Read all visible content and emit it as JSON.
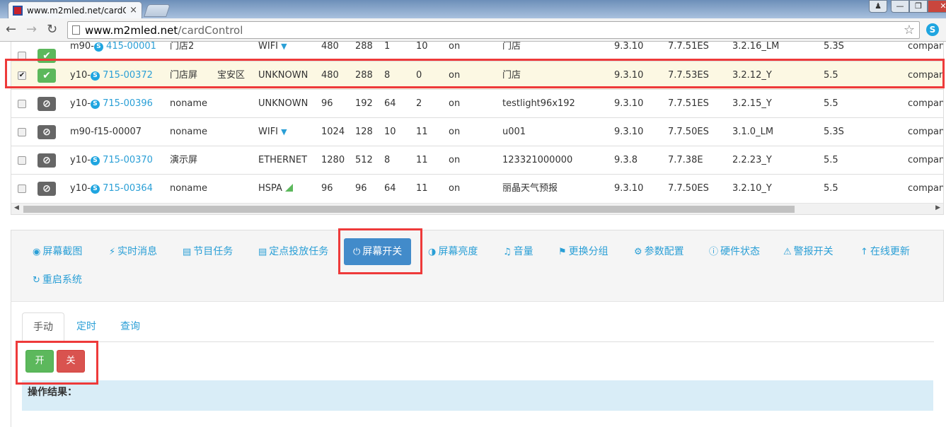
{
  "browser": {
    "tab_title": "www.m2mled.net/cardC",
    "tab_close": "×",
    "url_host": "www.m2mled.net",
    "url_path": "/cardControl",
    "user_icon": "user-icon",
    "window_controls": [
      "minimize",
      "maximize",
      "close"
    ]
  },
  "devices": [
    {
      "selected": false,
      "online": true,
      "id_prefix": "m90-",
      "id_link": "415-00001",
      "has_skype": true,
      "name": "门店2",
      "area": "",
      "network": "WIFI",
      "net_icon": "wifi",
      "width": "480",
      "height": "288",
      "c5": "1",
      "c6": "10",
      "power": "on",
      "group": "门店",
      "v1": "9.3.10",
      "v2": "7.7.51ES",
      "v3": "3.2.16_LM",
      "v4": "5.3S",
      "company": "compan"
    },
    {
      "selected": true,
      "online": true,
      "id_prefix": "y10-",
      "id_link": "715-00372",
      "has_skype": true,
      "name": "门店屏",
      "area": "宝安区",
      "network": "UNKNOWN",
      "net_icon": "",
      "width": "480",
      "height": "288",
      "c5": "8",
      "c6": "0",
      "power": "on",
      "group": "门店",
      "v1": "9.3.10",
      "v2": "7.7.53ES",
      "v3": "3.2.12_Y",
      "v4": "5.5",
      "company": "compan"
    },
    {
      "selected": false,
      "online": false,
      "id_prefix": "y10-",
      "id_link": "715-00396",
      "has_skype": true,
      "name": "noname",
      "area": "",
      "network": "UNKNOWN",
      "net_icon": "",
      "width": "96",
      "height": "192",
      "c5": "64",
      "c6": "2",
      "power": "on",
      "group": "testlight96x192",
      "v1": "9.3.10",
      "v2": "7.7.51ES",
      "v3": "3.2.15_Y",
      "v4": "5.5",
      "company": "compan"
    },
    {
      "selected": false,
      "online": false,
      "id_prefix": "m90-f15-00007",
      "id_link": "",
      "has_skype": false,
      "name": "noname",
      "area": "",
      "network": "WIFI",
      "net_icon": "wifi",
      "width": "1024",
      "height": "128",
      "c5": "10",
      "c6": "11",
      "power": "on",
      "group": "u001",
      "v1": "9.3.10",
      "v2": "7.7.50ES",
      "v3": "3.1.0_LM",
      "v4": "5.3S",
      "company": "compan"
    },
    {
      "selected": false,
      "online": false,
      "id_prefix": "y10-",
      "id_link": "715-00370",
      "has_skype": true,
      "name": "演示屏",
      "area": "",
      "network": "ETHERNET",
      "net_icon": "",
      "width": "1280",
      "height": "512",
      "c5": "8",
      "c6": "11",
      "power": "on",
      "group": "123321000000",
      "v1": "9.3.8",
      "v2": "7.7.38E",
      "v3": "2.2.23_Y",
      "v4": "5.5",
      "company": "compan"
    },
    {
      "selected": false,
      "online": false,
      "id_prefix": "y10-",
      "id_link": "715-00364",
      "has_skype": true,
      "name": "noname",
      "area": "",
      "network": "HSPA",
      "net_icon": "hspa",
      "width": "96",
      "height": "96",
      "c5": "64",
      "c6": "11",
      "power": "on",
      "group": "丽晶天气预报",
      "v1": "9.3.10",
      "v2": "7.7.50ES",
      "v3": "3.2.10_Y",
      "v4": "5.5",
      "company": "compan"
    }
  ],
  "functions": [
    {
      "label": "屏幕截图",
      "icon": "camera-icon"
    },
    {
      "label": "实时消息",
      "icon": "bolt-icon"
    },
    {
      "label": "节目任务",
      "icon": "film-icon"
    },
    {
      "label": "定点投放任务",
      "icon": "film-icon"
    },
    {
      "label": "屏幕开关",
      "icon": "power-icon",
      "active": true
    },
    {
      "label": "屏幕亮度",
      "icon": "brightness-icon"
    },
    {
      "label": "音量",
      "icon": "volume-icon"
    },
    {
      "label": "更换分组",
      "icon": "tag-icon"
    },
    {
      "label": "参数配置",
      "icon": "gear-icon"
    },
    {
      "label": "硬件状态",
      "icon": "info-icon"
    },
    {
      "label": "警报开关",
      "icon": "warning-icon"
    },
    {
      "label": "在线更新",
      "icon": "arrow-up-icon"
    },
    {
      "label": "重启系统",
      "icon": "refresh-icon"
    }
  ],
  "tabs": [
    {
      "label": "手动",
      "active": true
    },
    {
      "label": "定时"
    },
    {
      "label": "查询"
    }
  ],
  "buttons": {
    "on": "开",
    "off": "关"
  },
  "result": {
    "label": "操作结果："
  },
  "colors": {
    "link": "#2a9fd6",
    "online": "#5cb85c",
    "offline": "#666666",
    "active_button": "#428bca",
    "on_button": "#5cb85c",
    "off_button": "#d9534f",
    "highlight": "#ee3a3a"
  }
}
